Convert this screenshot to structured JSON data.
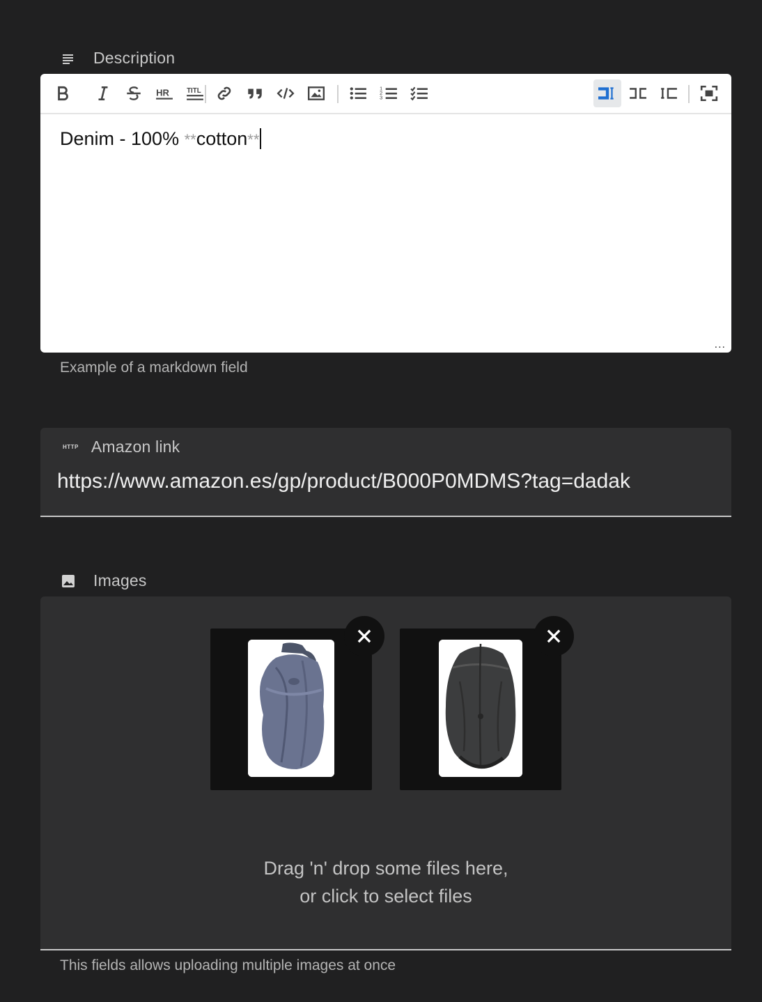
{
  "description_field": {
    "label": "Description",
    "icon": "notes-icon",
    "content_plain": "Denim - 100% ",
    "content_md_open": "**",
    "content_bold": "cotton",
    "content_md_close": "**",
    "helper": "Example of a markdown field",
    "toolbar": [
      "bold-icon",
      "italic-icon",
      "strikethrough-icon",
      "horizontal-rule-icon",
      "heading-icon",
      "link-icon",
      "quote-icon",
      "code-icon",
      "image-icon",
      "bullet-list-icon",
      "numbered-list-icon",
      "checklist-icon",
      "editor-mode-icon",
      "split-mode-icon",
      "preview-mode-icon",
      "fullscreen-icon"
    ],
    "resize_handle": "..."
  },
  "amazon_field": {
    "label": "Amazon link",
    "icon": "http-icon",
    "icon_text": "HTTP",
    "value": "https://www.amazon.es/gp/product/B000P0MDMS?tag=dadak"
  },
  "images_field": {
    "label": "Images",
    "icon": "image-icon",
    "images": [
      {
        "alt": "blue cap",
        "remove_icon": "close-icon"
      },
      {
        "alt": "black cap",
        "remove_icon": "close-icon"
      }
    ],
    "drop_line1": "Drag 'n' drop some files here,",
    "drop_line2": "or click to select files",
    "helper": "This fields allows uploading multiple images at once"
  },
  "colors": {
    "background": "#202021",
    "field_bg": "#2f2f30",
    "accent": "#1f6fd1"
  }
}
